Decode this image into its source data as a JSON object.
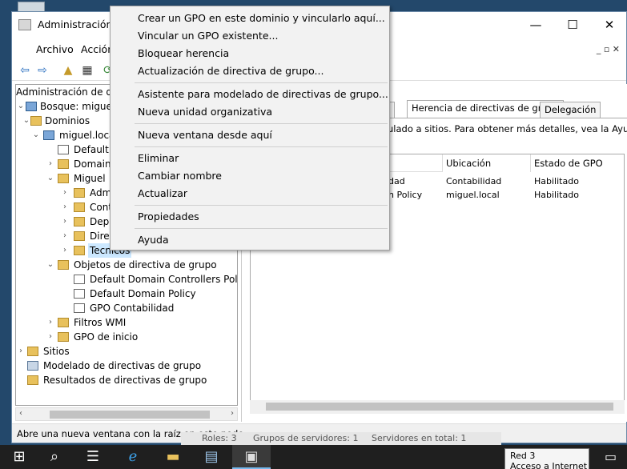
{
  "window": {
    "title": "Administración d",
    "minimize": "—",
    "maximize": "☐",
    "close": "✕"
  },
  "menubar": {
    "items": [
      "Archivo",
      "Acción"
    ],
    "window_controls": "_ ▫ ✕"
  },
  "tree": {
    "root": "Administración de dire",
    "forest": "Bosque: miguel.local",
    "domains": "Dominios",
    "domain": "miguel.local",
    "default_domain": "Default D",
    "domain_controllers": "Domain",
    "ou_miguel": "Miguel",
    "ou_admin": "Adm",
    "ou_contab": "Cont",
    "ou_depa": "Depa",
    "ou_dire": "Direc",
    "ou_tecnicos": "Tecnicos",
    "gpo_objects": "Objetos de directiva de grupo",
    "gpo_1": "Default Domain Controllers Policy",
    "gpo_2": "Default Domain Policy",
    "gpo_3": "GPO Contabilidad",
    "wmi": "Filtros WMI",
    "starter": "GPO de inicio",
    "sites": "Sitios",
    "modeling": "Modelado de directivas de grupo",
    "results": "Resultados de directivas de grupo"
  },
  "tabs": {
    "partial": "dos",
    "inheritance": "Herencia de directivas de grupo",
    "delegation": "Delegación"
  },
  "content": {
    "info": "ulado a sitios. Para obtener más detalles, vea la Ayuda.",
    "columns": [
      "Ubicación",
      "Estado de GPO"
    ],
    "rows": [
      {
        "name": "dad",
        "location": "Contabilidad",
        "status": "Habilitado"
      },
      {
        "name": "n Policy",
        "location": "miguel.local",
        "status": "Habilitado"
      }
    ]
  },
  "statusbar": {
    "text": "Abre una nueva ventana con la raíz en este nodo."
  },
  "behind": {
    "roles": "Roles: 3",
    "groups": "Grupos de servidores: 1",
    "servers": "Servidores en total: 1"
  },
  "context_menu": {
    "items": [
      "Crear un GPO en este dominio y vincularlo aquí...",
      "Vincular un GPO existente...",
      "Bloquear herencia",
      "Actualización de directiva de grupo...",
      "Asistente para modelado de directivas de grupo...",
      "Nueva unidad organizativa",
      "Nueva ventana desde aquí",
      "Eliminar",
      "Cambiar nombre",
      "Actualizar",
      "Propiedades",
      "Ayuda"
    ]
  },
  "tooltip": {
    "line1": "Red 3",
    "line2": "Acceso a Internet"
  },
  "taskbar": {
    "icons": [
      "windows-icon",
      "search-icon",
      "task-view-icon",
      "ie-icon",
      "explorer-icon",
      "server-manager-icon",
      "gpmc-icon",
      "notification-icon"
    ]
  }
}
